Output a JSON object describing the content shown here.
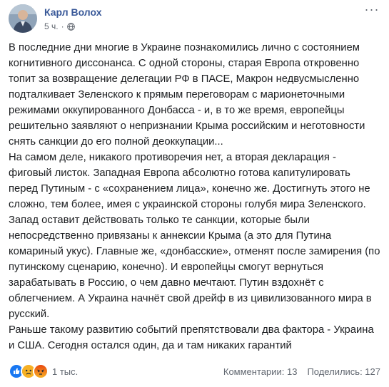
{
  "post": {
    "author": "Карл Волох",
    "time": "5 ч.",
    "privacy_icon": "globe-icon",
    "more_icon": "more-options-icon",
    "paragraphs": [
      "В последние дни многие в Украине познакомились лично с состоянием когнитивного диссонанса. С одной стороны, старая Европа откровенно топит за возвращение делегации РФ в ПАСЕ, Макрон недвусмысленно подталкивает Зеленского к прямым переговорам с марионеточными режимами оккупированного Донбасса - и, в то же время, европейцы решительно заявляют о непризнании Крыма российским и неготовности снять санкции до его полной деоккупации...",
      "На самом деле, никакого противоречия нет, а вторая декларация - фиговый листок. Западная Европа абсолютно готова капитулировать перед Путиным - с «сохранением лица», конечно же. Достигнуть этого не сложно, тем более, имея с украинской стороны голубя мира Зеленского. Запад оставит действовать только те санкции, которые были непосредственно привязаны к аннексии Крыма (а это для Путина комариный укус). Главные же, «донбасские», отменят после замирения (по путинскому сценарию, конечно). И европейцы смогут вернуться зарабатывать в Россию, о чем давно мечтают. Путин вздохнёт с облегчением. А Украина начнёт свой дрейф в из цивилизованного мира в русский.",
      "Раньше такому развитию событий препятствовали два фактора - Украина и США. Сегодня остался один, да и там никаких гарантий"
    ]
  },
  "footer": {
    "reactions": [
      "like-reaction-icon",
      "sad-reaction-icon",
      "angry-reaction-icon"
    ],
    "reaction_count": "1 тыс.",
    "comments": "Комментарии: 13",
    "shares": "Поделились: 127"
  },
  "colors": {
    "link": "#385898",
    "text": "#1c1e21",
    "muted": "#616770",
    "like": "#1877f2",
    "sad": "#f7b125",
    "angry": "#e9710f"
  }
}
